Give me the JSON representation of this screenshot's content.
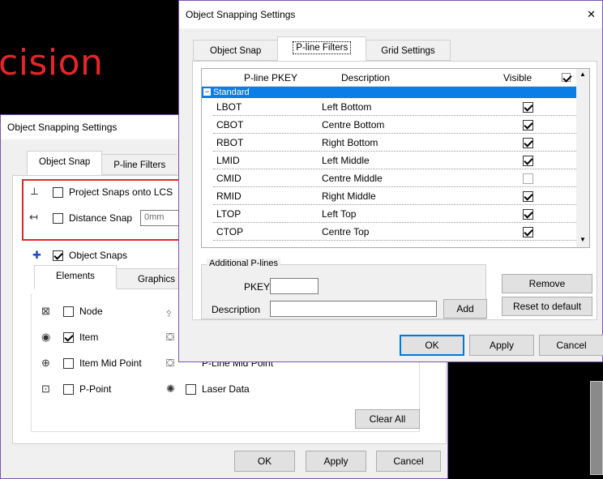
{
  "slide": {
    "title_partial": "cision"
  },
  "back_dialog": {
    "title": "Object Snapping Settings",
    "tabs": [
      "Object Snap",
      "P-line Filters"
    ],
    "project_snaps_label": "Project Snaps onto LCS",
    "distance_snap_label": "Distance Snap",
    "distance_snap_value": "0mm",
    "object_snaps_label": "Object Snaps",
    "subtabs": [
      "Elements",
      "Graphics"
    ],
    "snaps_left": [
      {
        "label": "Node",
        "checked": false,
        "icon": "node-snap-icon"
      },
      {
        "label": "Item",
        "checked": true,
        "icon": "item-snap-icon"
      },
      {
        "label": "Item Mid Point",
        "checked": false,
        "icon": "item-mid-point-icon"
      },
      {
        "label": "P-Point",
        "checked": false,
        "icon": "p-point-icon"
      }
    ],
    "snaps_right_partial": "P-Line Mid Point",
    "laser_data_label": "Laser Data",
    "clear_all_label": "Clear All",
    "ok_label": "OK",
    "apply_label": "Apply",
    "cancel_label": "Cancel"
  },
  "front_dialog": {
    "title": "Object Snapping Settings",
    "close_glyph": "✕",
    "tabs": [
      "Object Snap",
      "P-line Filters",
      "Grid Settings"
    ],
    "active_tab": "P-line Filters",
    "columns": [
      "P-line PKEY",
      "Description",
      "Visible"
    ],
    "group_name": "Standard",
    "rows": [
      {
        "pkey": "LBOT",
        "description": "Left Bottom",
        "visible": true
      },
      {
        "pkey": "CBOT",
        "description": "Centre Bottom",
        "visible": true
      },
      {
        "pkey": "RBOT",
        "description": "Right Bottom",
        "visible": true
      },
      {
        "pkey": "LMID",
        "description": "Left Middle",
        "visible": true
      },
      {
        "pkey": "CMID",
        "description": "Centre Middle",
        "visible": false
      },
      {
        "pkey": "RMID",
        "description": "Right Middle",
        "visible": true
      },
      {
        "pkey": "LTOP",
        "description": "Left Top",
        "visible": true
      },
      {
        "pkey": "CTOP",
        "description": "Centre Top",
        "visible": true
      }
    ],
    "additional_group_title": "Additional P-lines",
    "pkey_label": "PKEY",
    "pkey_value": "",
    "description_label": "Description",
    "description_value": "",
    "add_label": "Add",
    "remove_label": "Remove",
    "reset_label": "Reset to default",
    "ok_label": "OK",
    "apply_label": "Apply",
    "cancel_label": "Cancel"
  }
}
